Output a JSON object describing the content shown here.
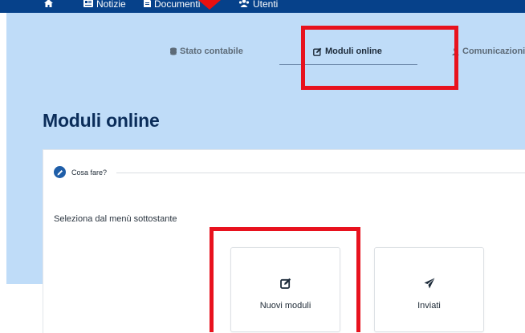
{
  "topnav": {
    "items": [
      {
        "label": "",
        "icon": "home-icon"
      },
      {
        "label": "Notizie",
        "icon": "newspaper-icon"
      },
      {
        "label": "Documenti",
        "icon": "document-icon"
      },
      {
        "label": "Utenti",
        "icon": "users-icon"
      }
    ]
  },
  "tabs": [
    {
      "label": "Stato contabile",
      "icon": "coins-icon",
      "active": false
    },
    {
      "label": "Moduli online",
      "icon": "edit-icon",
      "active": true
    },
    {
      "label": "Comunicazioni",
      "icon": "user-icon",
      "active": false
    }
  ],
  "page": {
    "title": "Moduli online"
  },
  "card": {
    "section_label": "Cosa fare?",
    "instruction": "Seleziona dal menù sottostante",
    "tiles": [
      {
        "label": "Nuovi moduli",
        "icon": "edit-icon"
      },
      {
        "label": "Inviati",
        "icon": "paper-plane-icon"
      }
    ]
  },
  "colors": {
    "nav_bar": "#06418a",
    "band": "#bfdcf8",
    "title": "#0b2d5a",
    "highlight_box": "#e8121e",
    "accent": "#1f5ea8"
  }
}
